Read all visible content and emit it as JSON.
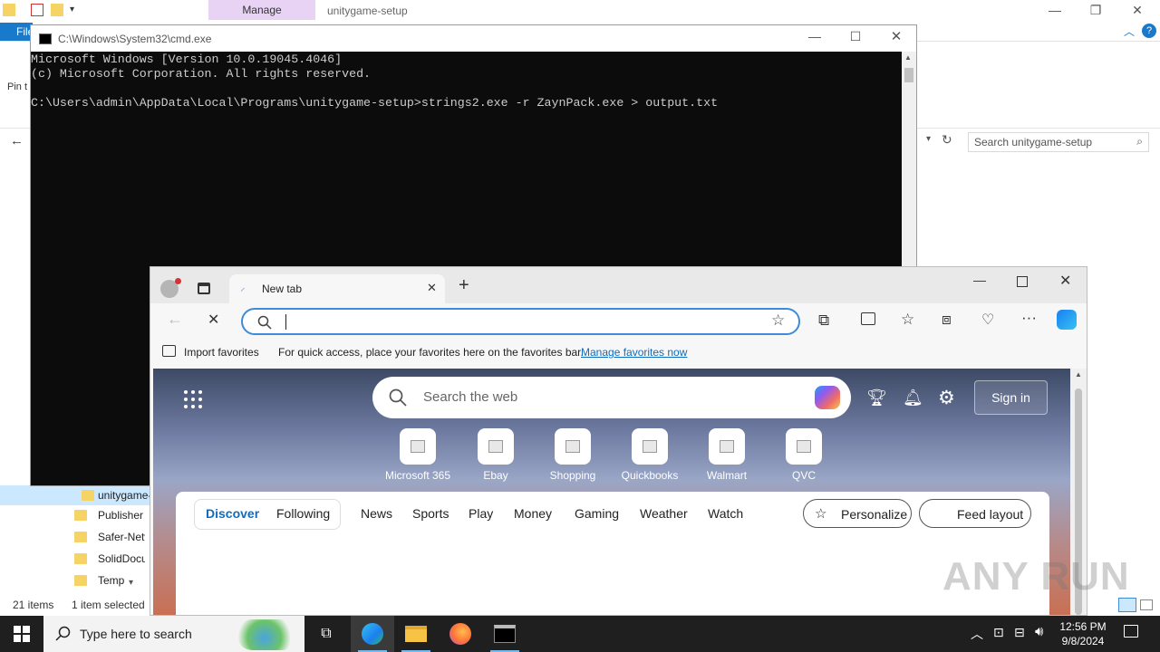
{
  "explorer": {
    "ribbon_tab_manage": "Manage",
    "title": "unitygame-setup",
    "file_tab": "File",
    "pin_label": "Pin t",
    "search_placeholder": "Search unitygame-setup",
    "nav_items": [
      {
        "label": "unitygame-setup",
        "selected": true
      },
      {
        "label": "Publisher"
      },
      {
        "label": "Safer-Networking"
      },
      {
        "label": "SolidDocuments"
      },
      {
        "label": "Temp"
      }
    ],
    "status_items": "21 items",
    "status_selected": "1 item selected"
  },
  "cmd": {
    "title": "C:\\Windows\\System32\\cmd.exe",
    "lines": [
      "Microsoft Windows [Version 10.0.19045.4046]",
      "(c) Microsoft Corporation. All rights reserved.",
      "",
      "C:\\Users\\admin\\AppData\\Local\\Programs\\unitygame-setup>strings2.exe -r ZaynPack.exe > output.txt"
    ]
  },
  "edge": {
    "tab_title": "New tab",
    "address_value": "",
    "favbar": {
      "import": "Import favorites",
      "hint": "For quick access, place your favorites here on the favorites bar.",
      "manage_link": "Manage favorites now"
    },
    "ntp": {
      "search_placeholder": "Search the web",
      "signin": "Sign in",
      "quick_links": [
        "Microsoft 365",
        "Ebay",
        "Shopping",
        "Quickbooks",
        "Walmart",
        "QVC"
      ],
      "feed_tabs": [
        "Discover",
        "Following",
        "News",
        "Sports",
        "Play",
        "Money",
        "Gaming",
        "Weather",
        "Watch"
      ],
      "personalize": "Personalize",
      "feed_layout": "Feed layout"
    }
  },
  "taskbar": {
    "search_placeholder": "Type here to search",
    "time": "12:56 PM",
    "date": "9/8/2024"
  },
  "watermark": "ANY RUN",
  "colors": {
    "cmd_bg": "#0c0c0c",
    "cmd_fg": "#cccccc",
    "edge_accent": "#3d8bd9",
    "feed_active": "#0f6cbd",
    "taskbar_bg": "#1f1f1f",
    "manage_tab": "#e8d3f5"
  }
}
